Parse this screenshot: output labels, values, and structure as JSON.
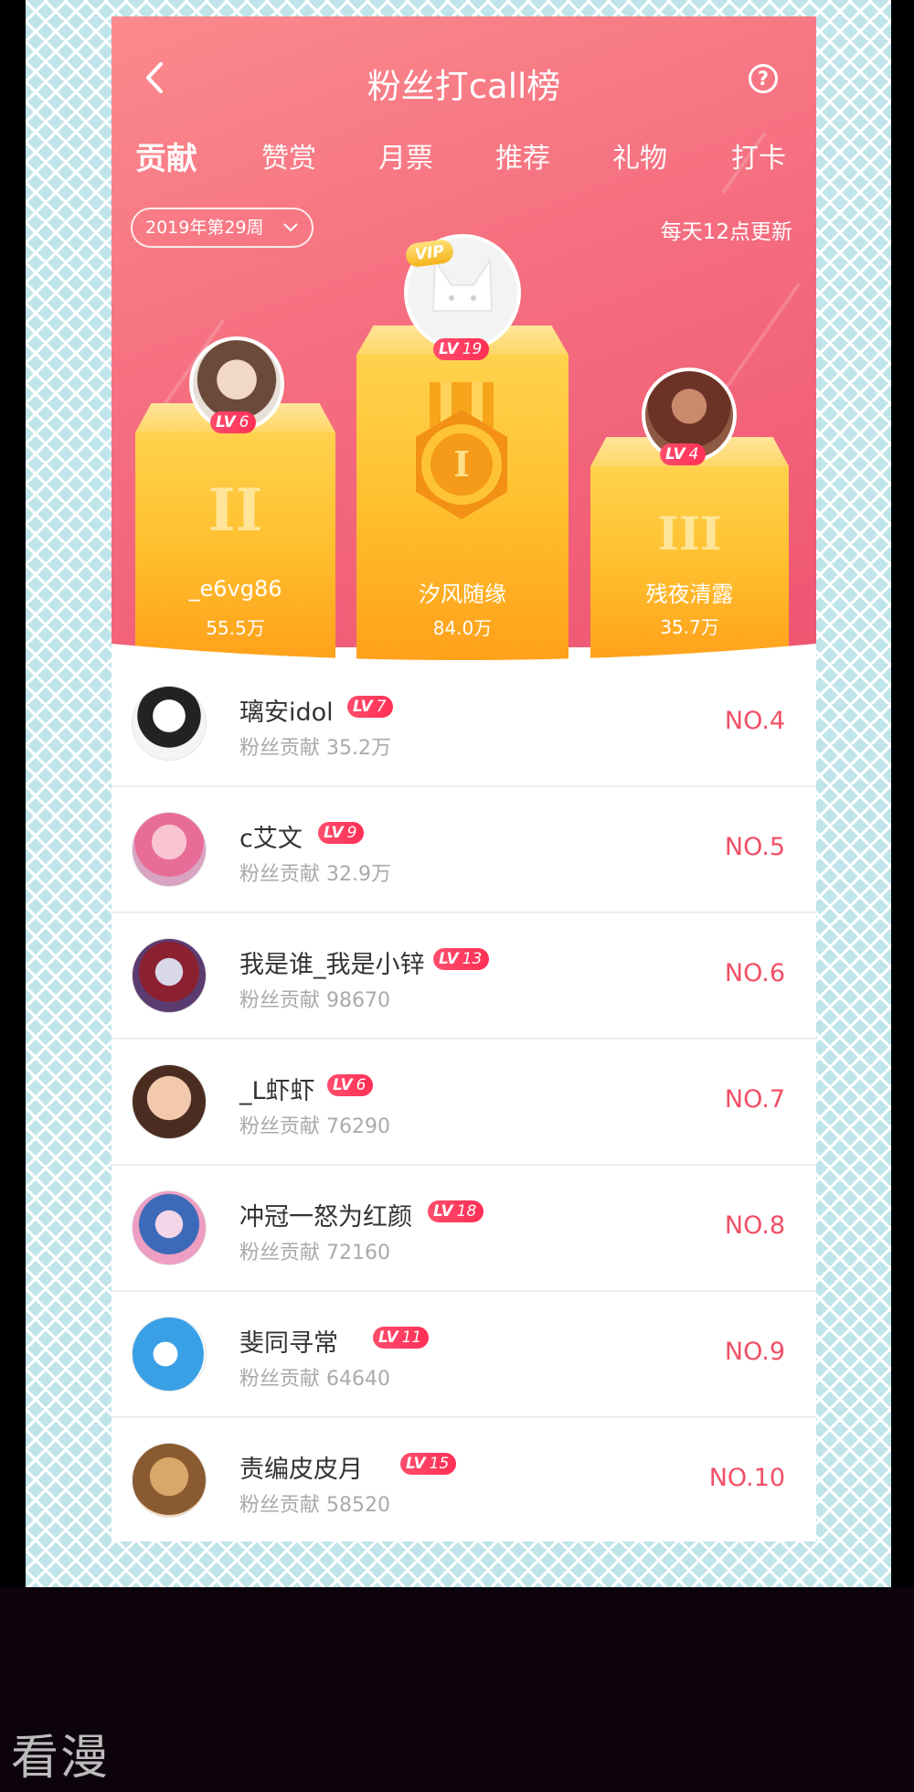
{
  "header": {
    "title": "粉丝打call榜",
    "tabs": [
      "贡献",
      "赞赏",
      "月票",
      "推荐",
      "礼物",
      "打卡"
    ],
    "active_tab": 0,
    "week_select": "2019年第29周",
    "update_note": "每天12点更新"
  },
  "podium": [
    {
      "place": "II",
      "name": "_e6vg86",
      "score": "55.5万",
      "level": "6"
    },
    {
      "place": "I",
      "name": "汐风随缘",
      "score": "84.0万",
      "level": "19",
      "badge": "VIP"
    },
    {
      "place": "III",
      "name": "残夜清露",
      "score": "35.7万",
      "level": "4"
    }
  ],
  "level_prefix": "LV",
  "contrib_prefix": "粉丝贡献",
  "rows": [
    {
      "name": "璃安idol",
      "level": "7",
      "contrib": "粉丝贡献 35.2万",
      "rank": "NO.4"
    },
    {
      "name": "c艾文",
      "level": "9",
      "contrib": "粉丝贡献 32.9万",
      "rank": "NO.5"
    },
    {
      "name": "我是谁_我是小锌",
      "level": "13",
      "contrib": "粉丝贡献 98670",
      "rank": "NO.6"
    },
    {
      "name": "_L虾虾",
      "level": "6",
      "contrib": "粉丝贡献 76290",
      "rank": "NO.7"
    },
    {
      "name": "冲冠一怒为红颜",
      "level": "18",
      "contrib": "粉丝贡献 72160",
      "rank": "NO.8"
    },
    {
      "name": "斐同寻常",
      "level": "11",
      "contrib": "粉丝贡献 64640",
      "rank": "NO.9"
    },
    {
      "name": "责编皮皮月",
      "level": "15",
      "contrib": "粉丝贡献 58520",
      "rank": "NO.10"
    }
  ],
  "watermark": "看漫",
  "colors": {
    "header_start": "#fb8a8c",
    "header_end": "#ee5572",
    "podium": "#ffbf2e",
    "rank": "#f24f66",
    "pattern": "#bfe4e9"
  }
}
